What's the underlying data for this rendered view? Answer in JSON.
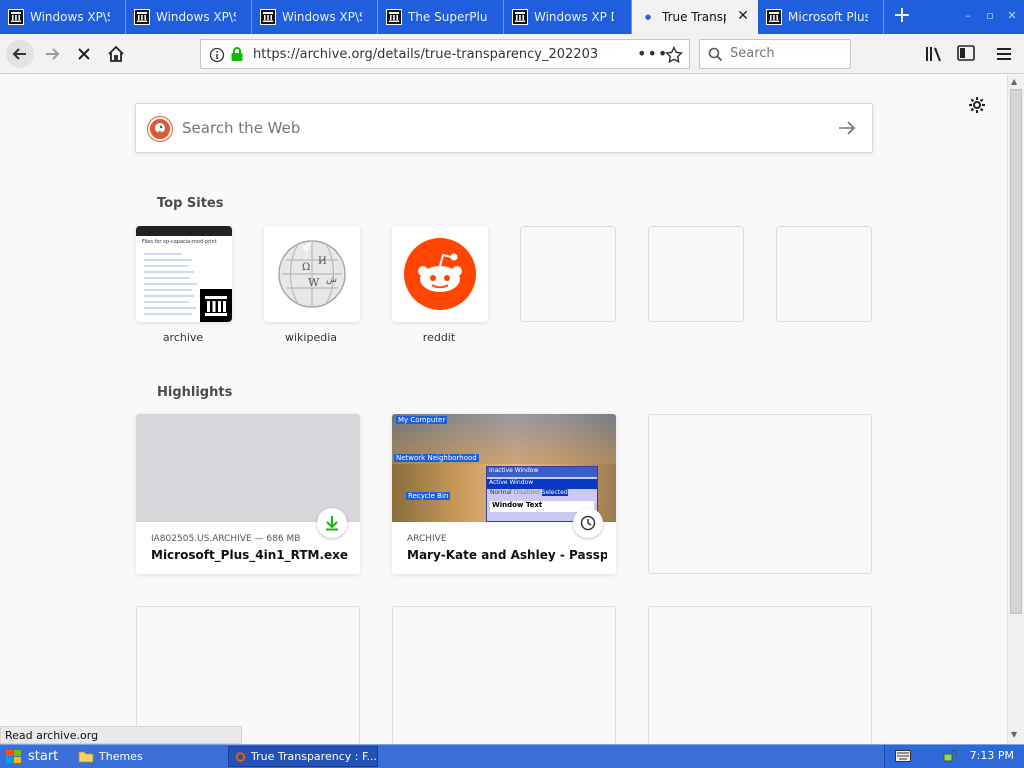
{
  "tabs": [
    {
      "title": "Windows XP\\Server",
      "favicon": "archive-icon"
    },
    {
      "title": "Windows XP\\Server",
      "favicon": "archive-icon"
    },
    {
      "title": "Windows XP\\Server",
      "favicon": "archive-icon"
    },
    {
      "title": "The SuperPlus! pack",
      "favicon": "archive-icon"
    },
    {
      "title": "Windows XP Dark",
      "favicon": "archive-icon"
    },
    {
      "title": "True Transparency",
      "favicon": "loading-icon",
      "active": true
    },
    {
      "title": "Microsoft Plus! Super",
      "favicon": "archive-icon"
    }
  ],
  "toolbar": {
    "url": "https://archive.org/details/true-transparency_202203",
    "search_placeholder": "Search"
  },
  "newtab": {
    "search_placeholder": "Search the Web",
    "top_sites_title": "Top Sites",
    "top_sites": [
      {
        "label": "archive"
      },
      {
        "label": "wikipedia"
      },
      {
        "label": "reddit"
      },
      {
        "label": ""
      },
      {
        "label": ""
      },
      {
        "label": ""
      }
    ],
    "archive_thumb_heading": "Files for xp-capacia-mod-print",
    "highlights_title": "Highlights",
    "highlights": [
      {
        "source": "IA802505.US.ARCHIVE — 686 MB",
        "name": "Microsoft_Plus_4in1_RTM.exe",
        "badge": "download-icon"
      },
      {
        "source": "ARCHIVE",
        "name": "Mary-Kate and Ashley - Passport...",
        "badge": "clock-icon",
        "thumb_labels": {
          "my_computer": "My Computer",
          "network": "Network Neighborhood",
          "recycle": "Recycle Bin",
          "inactive": "Inactive Window",
          "active": "Active Window",
          "window_text": "Window Text",
          "normal": "Normal",
          "disabled": "Disabled",
          "selected": "Selected"
        }
      }
    ]
  },
  "status": "Read archive.org",
  "taskbar": {
    "start_label": "start",
    "items": [
      {
        "label": "Themes"
      },
      {
        "label": "True Transparency : F..."
      }
    ],
    "clock": "7:13 PM"
  },
  "colors": {
    "tab_strip": "#1f5edc",
    "taskbar": "#3a6fd8",
    "reddit": "#ff4500",
    "duckduckgo": "#de5833",
    "download_green": "#12bc00"
  }
}
